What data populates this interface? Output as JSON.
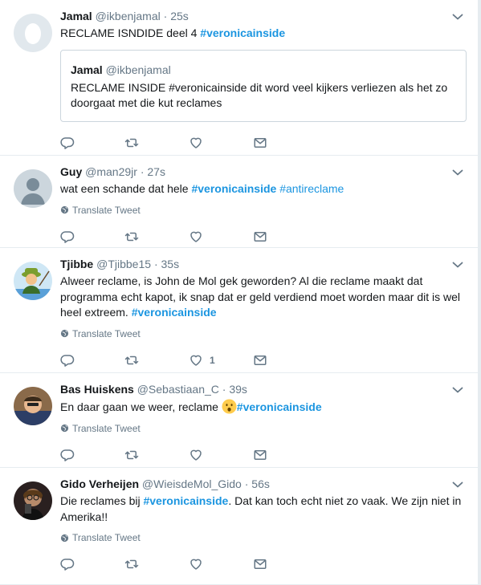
{
  "tweets": [
    {
      "name": "Jamal",
      "handle": "@ikbenjamal",
      "dot": "·",
      "time": "25s",
      "text_prefix": "RECLAME ISNDIDE deel 4 ",
      "hashtag": "#veronicainside",
      "quote": {
        "name": "Jamal",
        "handle": "@ikbenjamal",
        "line1": "RECLAME INSIDE  #veronicainside dit word veel kijkers verliezen als het zo",
        "line2": "doorgaat met die kut reclames"
      }
    },
    {
      "name": "Guy",
      "handle": "@man29jr",
      "dot": "·",
      "time": "27s",
      "text_prefix": "wat een schande dat hele ",
      "hashtag": "#veronicainside",
      "hashtag2": "#antireclame",
      "translate": "Translate Tweet"
    },
    {
      "name": "Tjibbe",
      "handle": "@Tjibbe15",
      "dot": "·",
      "time": "35s",
      "line1": "Alweer reclame, is John de Mol gek geworden? Al die reclame maakt dat",
      "line2": "programma echt kapot, ik snap dat er geld verdiend moet worden maar dit is wel",
      "line3_prefix": "heel extreem. ",
      "hashtag": "#veronicainside",
      "translate": "Translate Tweet",
      "like_count": "1"
    },
    {
      "name": "Bas Huiskens",
      "handle": "@Sebastiaan_C",
      "dot": "·",
      "time": "39s",
      "text_prefix": "En daar gaan we weer, reclame ",
      "hashtag": "#veronicainside",
      "translate": "Translate Tweet"
    },
    {
      "name": "Gido Verheijen",
      "handle": "@WieisdeMol_Gido",
      "dot": "·",
      "time": "56s",
      "text_prefix": "Die reclames bij ",
      "hashtag": "#veronicainside",
      "text_suffix": ". Dat kan toch echt niet zo vaak. We zijn niet in",
      "line2": "Amerika!!",
      "translate": "Translate Tweet"
    }
  ],
  "colors": {
    "accent": "#1b95e0",
    "muted": "#657786",
    "border": "#e6ecf0"
  },
  "icons": [
    "reply-icon",
    "retweet-icon",
    "like-icon",
    "dm-icon",
    "globe-icon",
    "chevron-down-icon",
    "surprised-emoji"
  ]
}
